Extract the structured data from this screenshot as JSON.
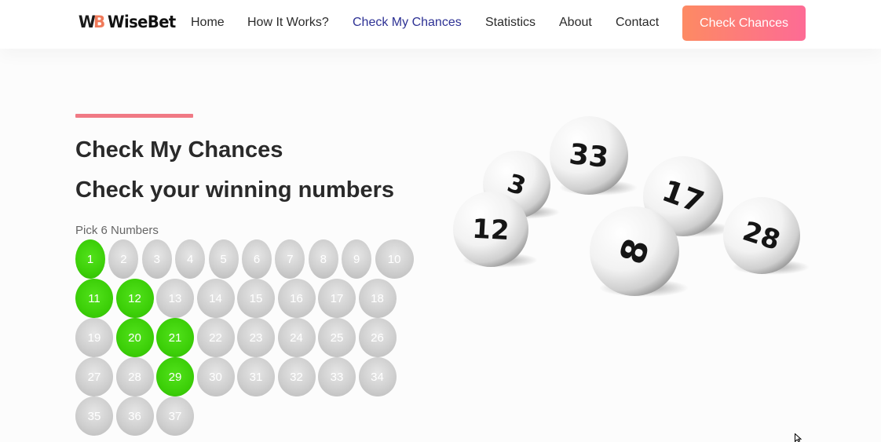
{
  "brand": {
    "mark": "WB",
    "name": "WiseBet"
  },
  "nav": {
    "items": [
      "Home",
      "How It Works?",
      "Check My Chances",
      "Statistics",
      "About",
      "Contact"
    ],
    "active": "Check My Chances",
    "cta": "Check Chances"
  },
  "hero": {
    "title": "Check My Chances",
    "subtitle": "Check your winning numbers",
    "pick_label": "Pick 6 Numbers"
  },
  "numbers": [
    1,
    2,
    3,
    4,
    5,
    6,
    7,
    8,
    9,
    10,
    11,
    12,
    13,
    14,
    15,
    16,
    17,
    18,
    19,
    20,
    21,
    22,
    23,
    24,
    25,
    26,
    27,
    28,
    29,
    30,
    31,
    32,
    33,
    34,
    35,
    36,
    37
  ],
  "selected": [
    1,
    11,
    12,
    20,
    21,
    29
  ],
  "image": {
    "balls": [
      "3",
      "33",
      "17",
      "12",
      "8",
      "28"
    ]
  },
  "colors": {
    "selected": "#3ccf08",
    "unselected": "#cfcfcf",
    "accent": "#f07a85",
    "cta_start": "#fd8a63",
    "cta_end": "#fd6b95",
    "active_nav": "#2d3194"
  }
}
